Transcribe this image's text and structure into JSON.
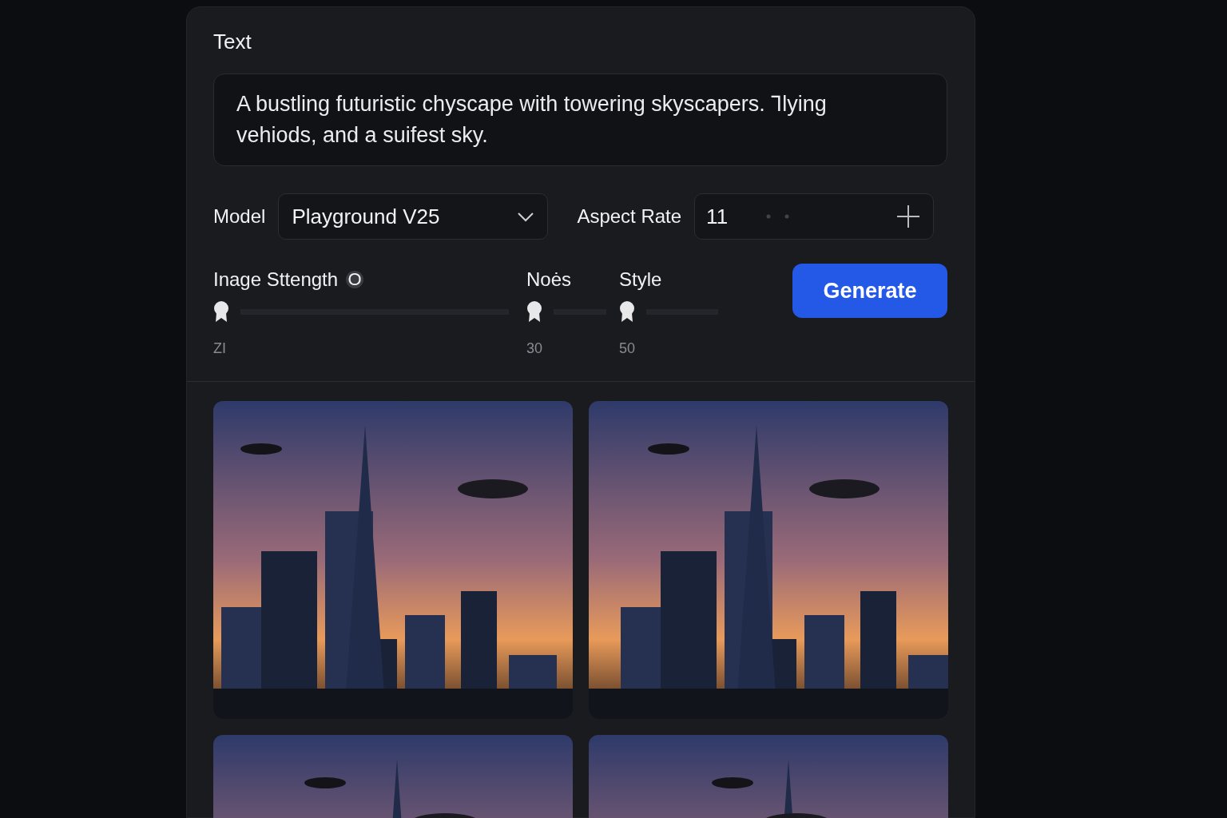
{
  "prompt_label": "Text",
  "prompt": "A bustling futuristic chyscape with towering skyscapers. Ꞁlying vehiods, and a suifest sky.",
  "model": {
    "label": "Model",
    "value": "Playground V25"
  },
  "aspect": {
    "label": "Aspect Rate",
    "value": "11"
  },
  "sliders": [
    {
      "label": "Inage Sttength",
      "badge": "O",
      "level": 0,
      "reading": "ZI"
    },
    {
      "label": "Noės",
      "level": 0,
      "reading": "30"
    },
    {
      "label": "Style",
      "level": 0,
      "reading": "50"
    }
  ],
  "generate": "Generate"
}
